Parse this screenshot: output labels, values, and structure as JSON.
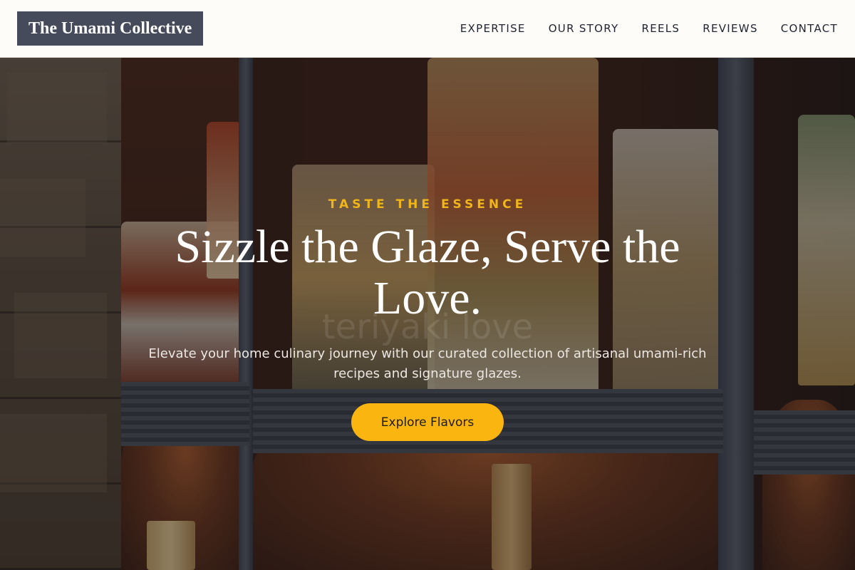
{
  "brand": {
    "name": "The Umami Collective"
  },
  "nav": {
    "items": [
      {
        "label": "EXPERTISE"
      },
      {
        "label": "OUR STORY"
      },
      {
        "label": "REELS"
      },
      {
        "label": "REVIEWS"
      },
      {
        "label": "CONTACT"
      }
    ]
  },
  "hero": {
    "eyebrow": "TASTE THE ESSENCE",
    "headline": "Sizzle the Glaze, Serve the Love.",
    "subtitle": "Elevate your home culinary journey with our curated collection of artisanal umami-rich recipes and signature glazes.",
    "cta_label": "Explore Flavors",
    "watermark": "teriyaki love"
  },
  "colors": {
    "header_bg": "#fdfcf8",
    "logo_bg": "#454b5a",
    "accent": "#fbb510",
    "eyebrow": "#f0b519"
  }
}
